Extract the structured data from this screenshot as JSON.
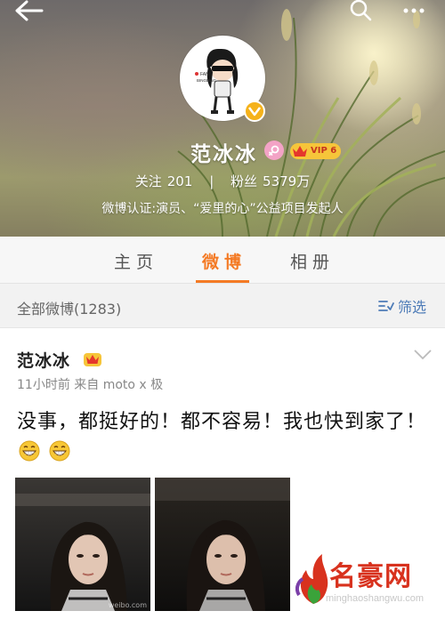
{
  "header": {
    "avatar_caption": "FAN BINGBING",
    "user_name": "范冰冰",
    "vip_label": "VIP 6",
    "following_label": "关注",
    "following_count": "201",
    "stats_separator": "|",
    "followers_label": "粉丝",
    "followers_count": "5379万",
    "verify_text": "微博认证:演员、“爱里的心”公益项目发起人"
  },
  "tabs": [
    {
      "label": "主页",
      "active": false
    },
    {
      "label": "微博",
      "active": true
    },
    {
      "label": "相册",
      "active": false
    }
  ],
  "filter": {
    "label": "全部微博(1283)",
    "button_label": "筛选"
  },
  "post": {
    "author": "范冰冰",
    "meta": "11小时前  来自 moto x 极",
    "text": "没事，都挺好的！都不容易！我也快到家了！",
    "emoji": [
      "grin-emoji",
      "grin-emoji"
    ],
    "photo_watermark": "weibo.com"
  },
  "watermark": {
    "name": "名豪网",
    "url": "minghaoshangwu.com"
  },
  "colors": {
    "accent": "#f47a24",
    "link": "#4d7bb7",
    "vip": "#f6c53a"
  }
}
